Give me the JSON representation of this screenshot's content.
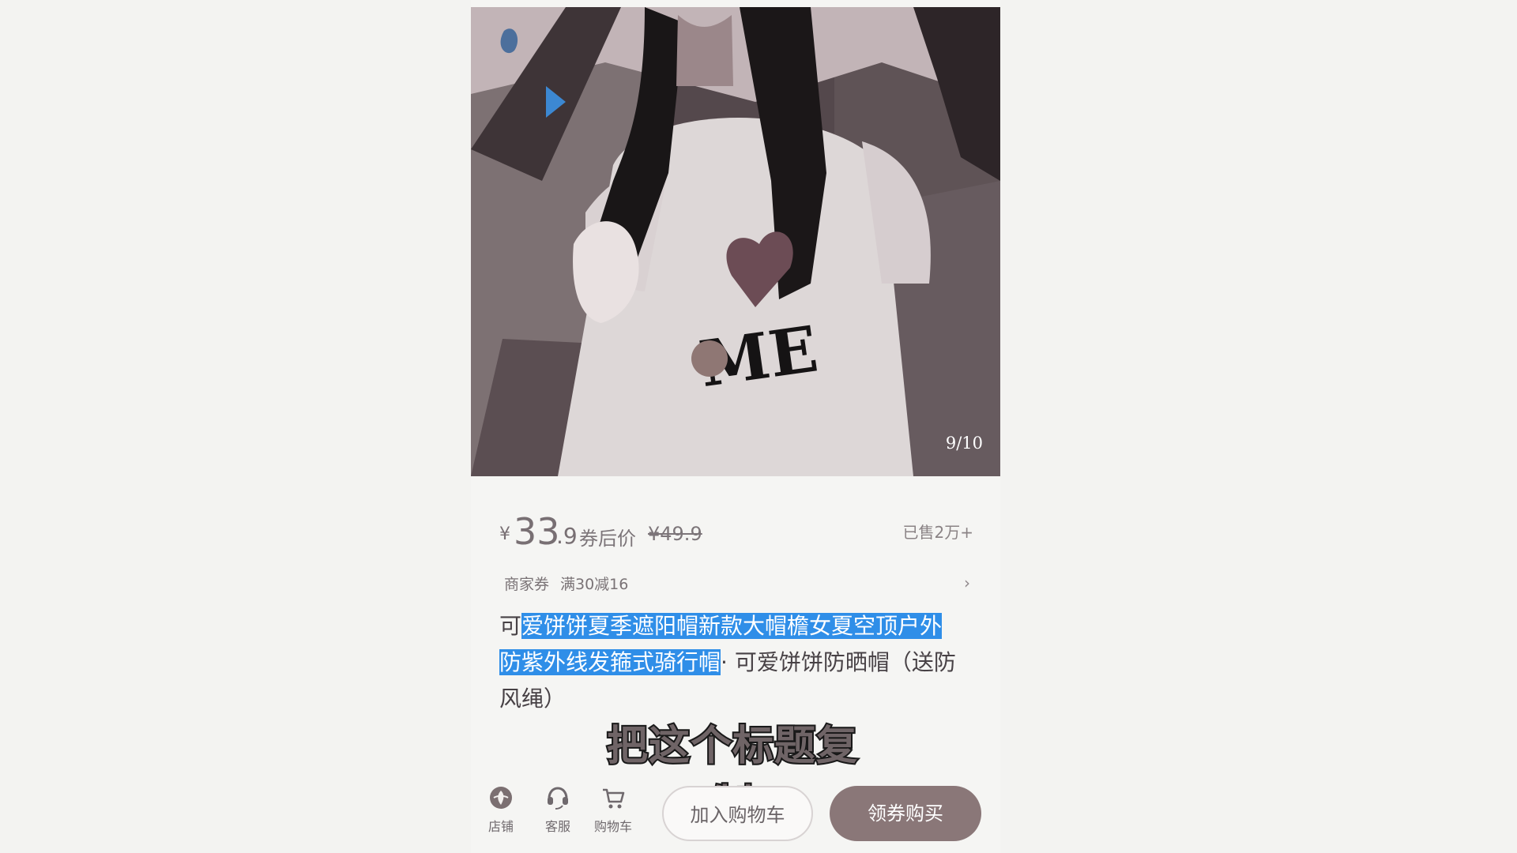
{
  "gallery": {
    "indicator": "9/10",
    "shirt_text": "ME"
  },
  "price": {
    "currency": "¥",
    "integer": "33",
    "decimal": ".9",
    "caption": "券后价",
    "original": "¥49.9",
    "sold": "已售2万+"
  },
  "coupon": {
    "label": "商家券",
    "value": "满30减16"
  },
  "title": {
    "line1_plain": "可",
    "line1_selected": "爱饼饼夏季遮阳帽新款大帽檐女夏空顶户外",
    "line2_selected": "防紫外线发箍式骑行帽",
    "line2_rest": "· 可爱饼饼防晒帽（送防",
    "line3": "风绳）"
  },
  "subtitle": "把这个标题复制",
  "bottom_bar": {
    "store": "店铺",
    "service": "客服",
    "cart": "购物车",
    "add_to_cart": "加入购物车",
    "buy": "领券购买"
  },
  "colors": {
    "selection": "#2f8ee8",
    "buy_button": "#8a7778"
  }
}
